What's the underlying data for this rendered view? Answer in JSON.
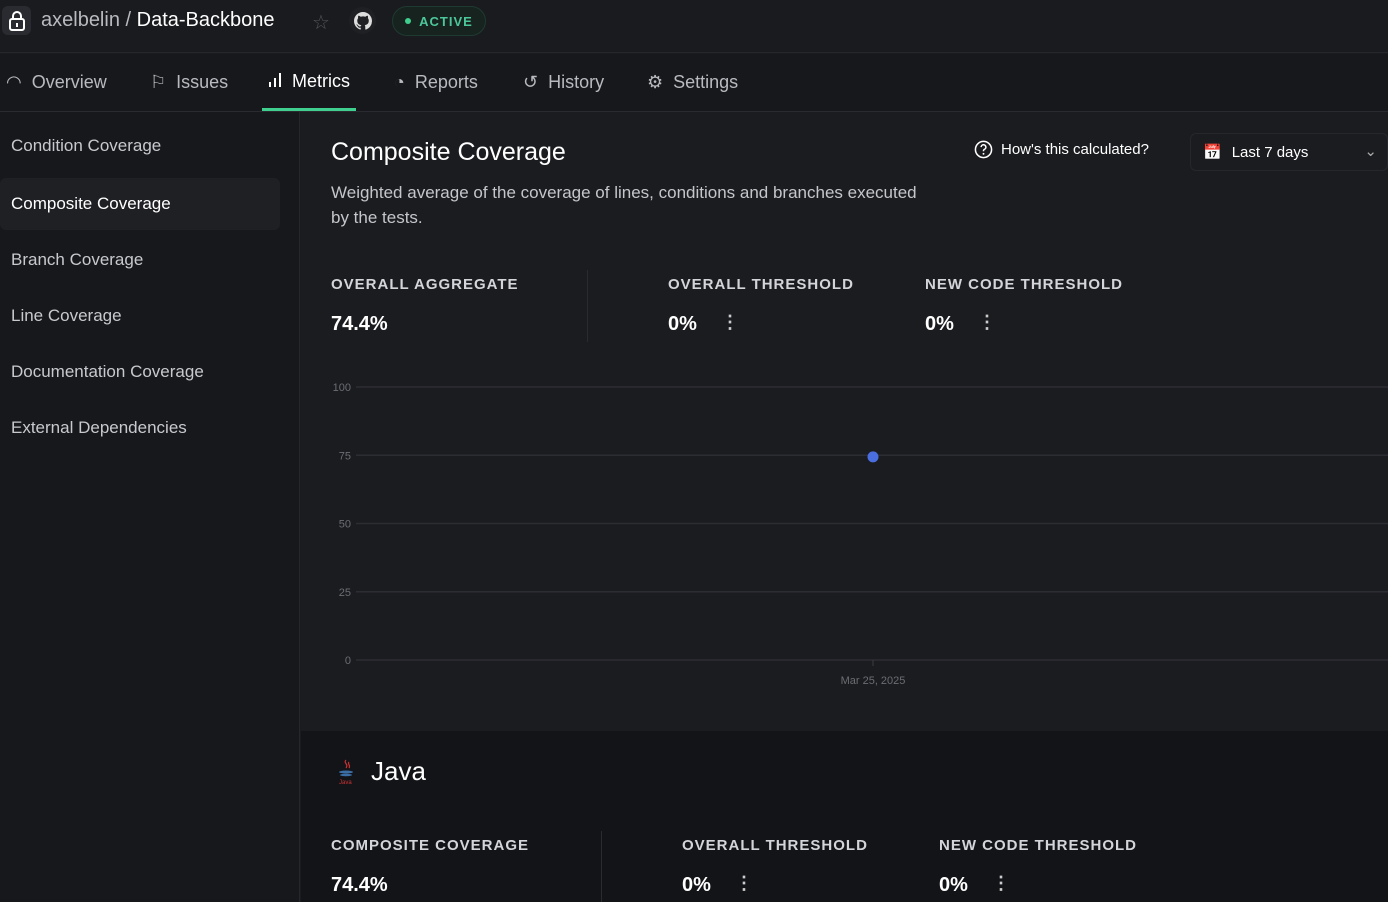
{
  "header": {
    "owner": "axelbelin",
    "separator": " / ",
    "repo": "Data-Backbone",
    "status": "ACTIVE"
  },
  "tabs": [
    {
      "label": "Overview",
      "icon": "gauge-icon"
    },
    {
      "label": "Issues",
      "icon": "flag-icon"
    },
    {
      "label": "Metrics",
      "icon": "bar-chart-icon",
      "active": true
    },
    {
      "label": "Reports",
      "icon": "pie-chart-icon"
    },
    {
      "label": "History",
      "icon": "history-icon"
    },
    {
      "label": "Settings",
      "icon": "gear-icon"
    }
  ],
  "sidebar": {
    "items": [
      {
        "label": "Condition Coverage"
      },
      {
        "label": "Composite Coverage",
        "active": true
      },
      {
        "label": "Branch Coverage"
      },
      {
        "label": "Line Coverage"
      },
      {
        "label": "Documentation Coverage"
      },
      {
        "label": "External Dependencies"
      }
    ]
  },
  "main": {
    "title": "Composite Coverage",
    "description": "Weighted average of the coverage of lines, conditions and branches executed by the tests.",
    "help_label": "How's this calculated?",
    "range_label": "Last 7 days",
    "stats": [
      {
        "label": "OVERALL AGGREGATE",
        "value": "74.4%"
      },
      {
        "label": "OVERALL THRESHOLD",
        "value": "0%"
      },
      {
        "label": "NEW CODE THRESHOLD",
        "value": "0%"
      }
    ]
  },
  "chart_data": {
    "type": "scatter",
    "x": [
      "Mar 25, 2025"
    ],
    "values": [
      74.4
    ],
    "ylim": [
      0,
      100
    ],
    "yticks": [
      "100",
      "75",
      "50",
      "25",
      "0"
    ],
    "xlabel": "",
    "ylabel": "",
    "grid": true,
    "color": "#4a6ee0"
  },
  "java": {
    "title": "Java",
    "stats": [
      {
        "label": "COMPOSITE COVERAGE",
        "value": "74.4%"
      },
      {
        "label": "OVERALL THRESHOLD",
        "value": "0%"
      },
      {
        "label": "NEW CODE THRESHOLD",
        "value": "0%"
      }
    ]
  }
}
